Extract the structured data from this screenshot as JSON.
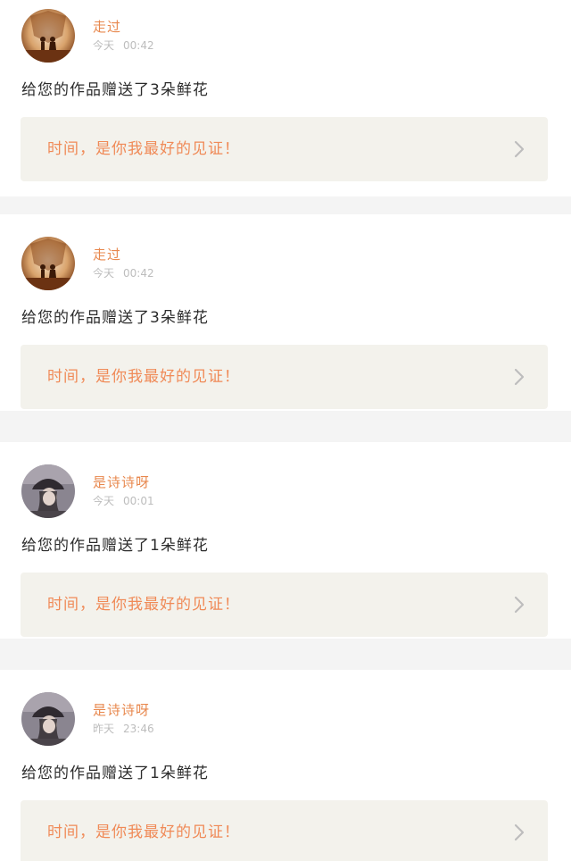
{
  "feed": [
    {
      "username": "走过",
      "day": "今天",
      "time": "00:42",
      "message": "给您的作品赠送了3朵鲜花",
      "work_title": "时间，是你我最好的见证！",
      "avatar": "couple-silhouette-avatar"
    },
    {
      "username": "走过",
      "day": "今天",
      "time": "00:42",
      "message": "给您的作品赠送了3朵鲜花",
      "work_title": "时间，是你我最好的见证！",
      "avatar": "couple-silhouette-avatar"
    },
    {
      "username": "是诗诗呀",
      "day": "今天",
      "time": "00:01",
      "message": "给您的作品赠送了1朵鲜花",
      "work_title": "时间，是你我最好的见证！",
      "avatar": "girl-hat-avatar"
    },
    {
      "username": "是诗诗呀",
      "day": "昨天",
      "time": "23:46",
      "message": "给您的作品赠送了1朵鲜花",
      "work_title": "时间，是你我最好的见证！",
      "avatar": "girl-hat-avatar"
    }
  ],
  "colors": {
    "username": "#e8884e",
    "work_title": "#f08a57",
    "work_box_bg": "#f3f2ec",
    "separator_bg": "#f4f4f4"
  },
  "icons": {
    "chevron": "chevron-right-icon"
  }
}
